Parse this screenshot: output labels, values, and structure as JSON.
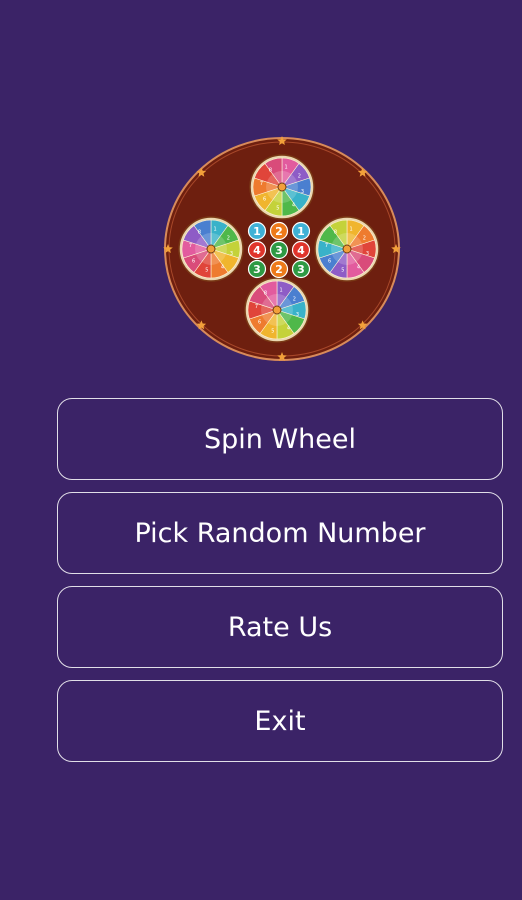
{
  "logo": {
    "icon": "spin-wheel-logo",
    "wheel_numbers": [
      "1",
      "2",
      "3",
      "4",
      "5",
      "6",
      "7",
      "8"
    ],
    "ball_numbers": [
      "1",
      "2",
      "1",
      "4",
      "3",
      "4",
      "3",
      "2",
      "3"
    ]
  },
  "menu": {
    "spin_wheel": "Spin Wheel",
    "pick_random_number": "Pick Random Number",
    "rate_us": "Rate Us",
    "exit": "Exit"
  },
  "colors": {
    "background": "#3b2367",
    "board": "#6e1f0f",
    "star": "#f2a03a",
    "button_border": "#ffffff",
    "ball_blue": "#3fb1d6",
    "ball_orange": "#ee7a1a",
    "ball_red": "#e0342b",
    "ball_green": "#2e9a44"
  }
}
